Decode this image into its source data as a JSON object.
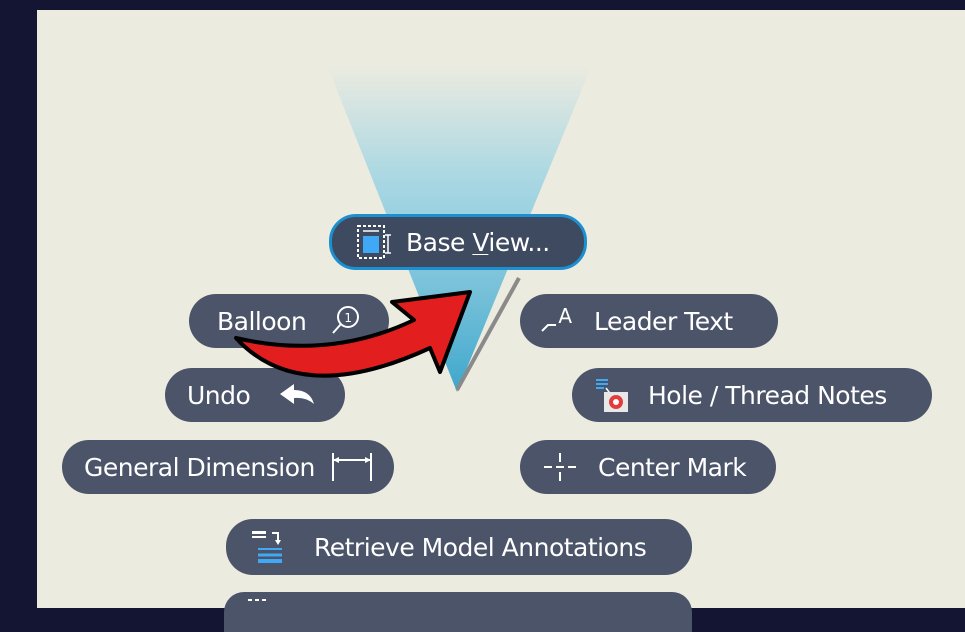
{
  "marking_menu": {
    "center": {
      "label_pre": "Base ",
      "label_mnemonic": "V",
      "label_post": "iew...",
      "icon": "base-view-icon"
    },
    "items": {
      "balloon": {
        "label": "Balloon",
        "icon": "balloon-icon"
      },
      "leader_text": {
        "label": "Leader Text",
        "icon": "leader-text-icon"
      },
      "undo": {
        "label": "Undo",
        "icon": "undo-arrow-icon"
      },
      "hole_thread_notes": {
        "label": "Hole / Thread Notes",
        "icon": "hole-thread-notes-icon"
      },
      "general_dimension": {
        "label": "General Dimension",
        "icon": "general-dimension-icon"
      },
      "center_mark": {
        "label": "Center Mark",
        "icon": "center-mark-icon"
      },
      "retrieve_model_annotations": {
        "label": "Retrieve Model Annotations",
        "icon": "retrieve-model-annotations-icon"
      }
    }
  },
  "colors": {
    "frame": "#141533",
    "canvas": "#ecebe0",
    "pill": "#4b5468",
    "selected_border": "#1b8fd0",
    "cone": "#8ccfe4",
    "arrow": "#e31e1e"
  }
}
